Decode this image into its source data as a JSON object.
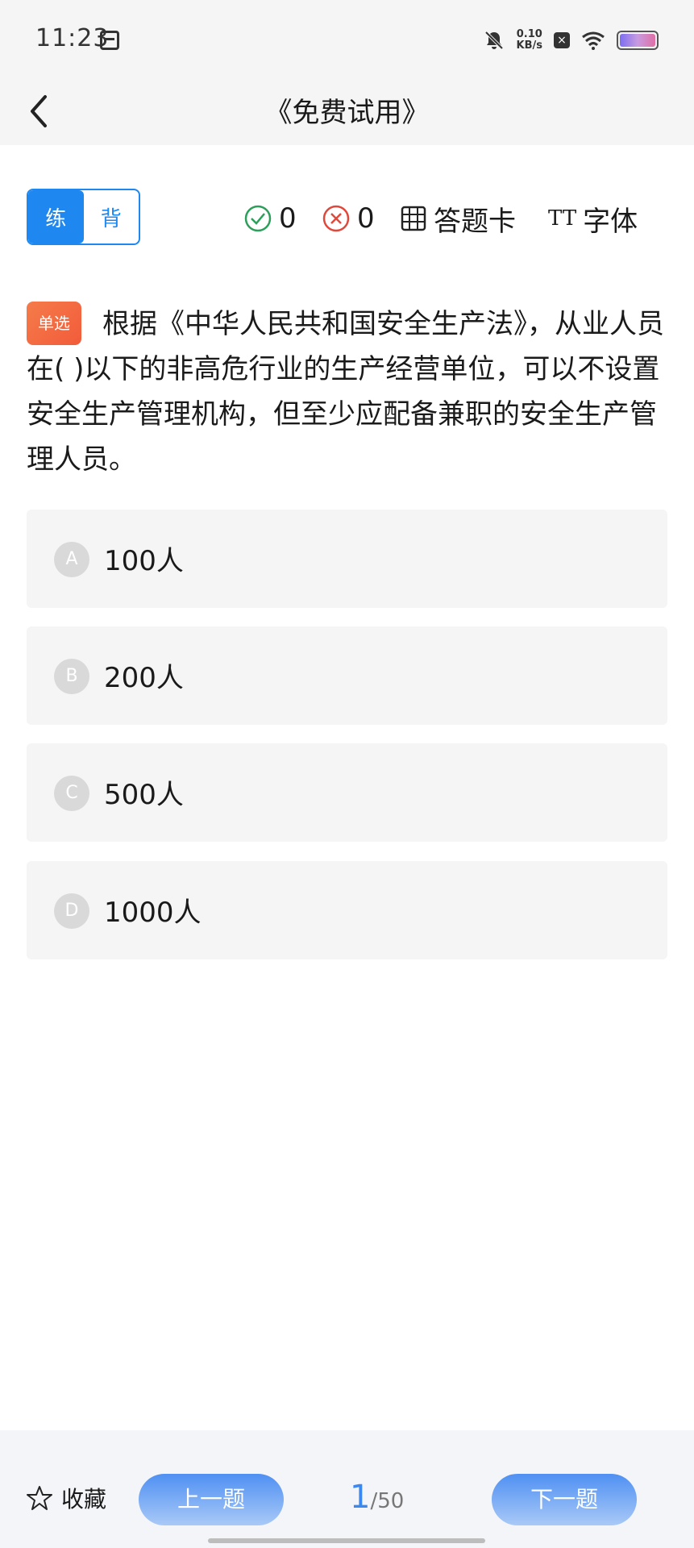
{
  "status_bar": {
    "time": "11:23",
    "network_speed_value": "0.10",
    "network_speed_unit": "KB/s",
    "battery_colors": [
      "#7b6ff0",
      "#e06fa5"
    ]
  },
  "header": {
    "title": "《免费试用》",
    "back_icon": "chevron-left-icon"
  },
  "toolbar": {
    "mode_practice": "练",
    "mode_recite": "背",
    "correct_count": "0",
    "wrong_count": "0",
    "answer_card_label": "答题卡",
    "font_label": "字体",
    "font_icon_text": "TT"
  },
  "question": {
    "type_badge": "单选",
    "text": "根据《中华人民共和国安全生产法》，从业人员在( )以下的非高危行业的生产经营单位，可以不设置安全生产管理机构，但至少应配备兼职的安全生产管理人员。"
  },
  "options": [
    {
      "letter": "A",
      "text": "100人"
    },
    {
      "letter": "B",
      "text": "200人"
    },
    {
      "letter": "C",
      "text": "500人"
    },
    {
      "letter": "D",
      "text": "1000人"
    }
  ],
  "bottom_bar": {
    "favorite_label": "收藏",
    "prev_label": "上一题",
    "next_label": "下一题",
    "current_index": "1",
    "total": "/50"
  },
  "colors": {
    "accent": "#1e88f0",
    "badge": "#f25b3a",
    "correct": "#2e9e5b",
    "wrong": "#e0483c"
  }
}
